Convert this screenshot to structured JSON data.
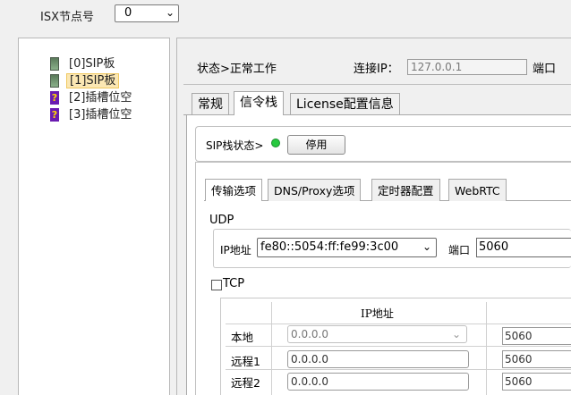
{
  "node": {
    "label": "ISX节点号",
    "selected": "0"
  },
  "tree": {
    "items": [
      {
        "label": "[0]SIP板",
        "icon": "board-icon"
      },
      {
        "label": "[1]SIP板",
        "icon": "board-icon",
        "selected": true
      },
      {
        "label": "[2]插槽位空",
        "icon": "question-icon"
      },
      {
        "label": "[3]插槽位空",
        "icon": "question-icon"
      }
    ]
  },
  "status": {
    "text": "状态>正常工作",
    "ip_label": "连接IP：",
    "ip_value": "127.0.0.1",
    "port_label": "端口"
  },
  "tabs": [
    "常规",
    "信令栈",
    "License配置信息"
  ],
  "sip": {
    "status_label": "SIP栈状态>",
    "led_color": "#27c93f",
    "stop_button": "停用"
  },
  "inner_tabs": [
    "传输选项",
    "DNS/Proxy选项",
    "定时器配置",
    "WebRTC"
  ],
  "udp": {
    "label": "UDP",
    "ip_label": "IP地址",
    "ip_value": "fe80::5054:ff:fe99:3c00",
    "port_label": "端口",
    "port_value": "5060"
  },
  "tcp": {
    "label": "TCP",
    "checked": false,
    "header_ip": "IP地址",
    "rows": [
      {
        "label": "本地",
        "ip": "0.0.0.0",
        "port": "5060"
      },
      {
        "label": "远程1",
        "ip": "0.0.0.0",
        "port": "5060"
      },
      {
        "label": "远程2",
        "ip": "0.0.0.0",
        "port": "5060"
      }
    ]
  }
}
